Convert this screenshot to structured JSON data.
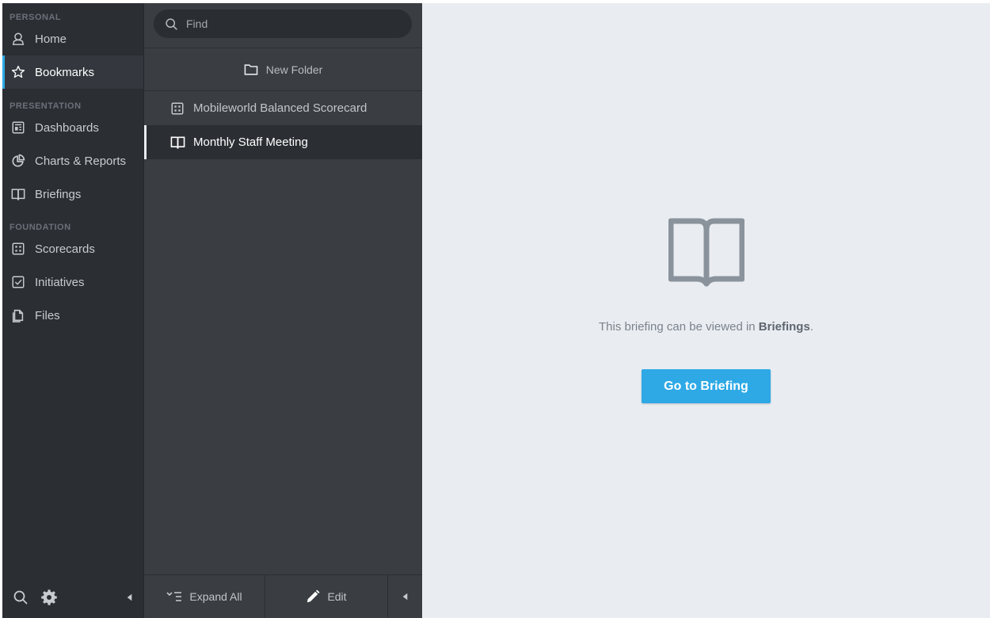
{
  "sidebar": {
    "sections": [
      {
        "header": "PERSONAL"
      },
      {
        "header": "PRESENTATION"
      },
      {
        "header": "FOUNDATION"
      }
    ],
    "items": [
      {
        "label": "Home",
        "icon": "user-icon"
      },
      {
        "label": "Bookmarks",
        "icon": "star-icon",
        "active": true
      },
      {
        "label": "Dashboards",
        "icon": "dashboard-icon"
      },
      {
        "label": "Charts & Reports",
        "icon": "pie-chart-icon"
      },
      {
        "label": "Briefings",
        "icon": "book-icon"
      },
      {
        "label": "Scorecards",
        "icon": "scorecard-icon"
      },
      {
        "label": "Initiatives",
        "icon": "checkbox-icon"
      },
      {
        "label": "Files",
        "icon": "files-icon"
      }
    ],
    "footer": {
      "search_icon": "search-icon",
      "settings_icon": "gear-icon",
      "collapse_icon": "triangle-left-icon"
    }
  },
  "middle": {
    "search": {
      "placeholder": "Find",
      "value": ""
    },
    "new_folder_label": "New Folder",
    "list": [
      {
        "label": "Mobileworld Balanced Scorecard",
        "icon": "scorecard-icon"
      },
      {
        "label": "Monthly Staff Meeting",
        "icon": "book-icon",
        "selected": true
      }
    ],
    "footer": {
      "expand_label": "Expand All",
      "edit_label": "Edit"
    }
  },
  "content": {
    "icon": "book-icon",
    "message_prefix": "This briefing can be viewed in ",
    "message_bold": "Briefings",
    "message_suffix": ".",
    "button_label": "Go to Briefing"
  },
  "colors": {
    "accent": "#2ea9e6",
    "sidebar_bg": "#2b2e33",
    "middle_bg": "#3a3d42",
    "content_bg": "#e9edf2"
  }
}
